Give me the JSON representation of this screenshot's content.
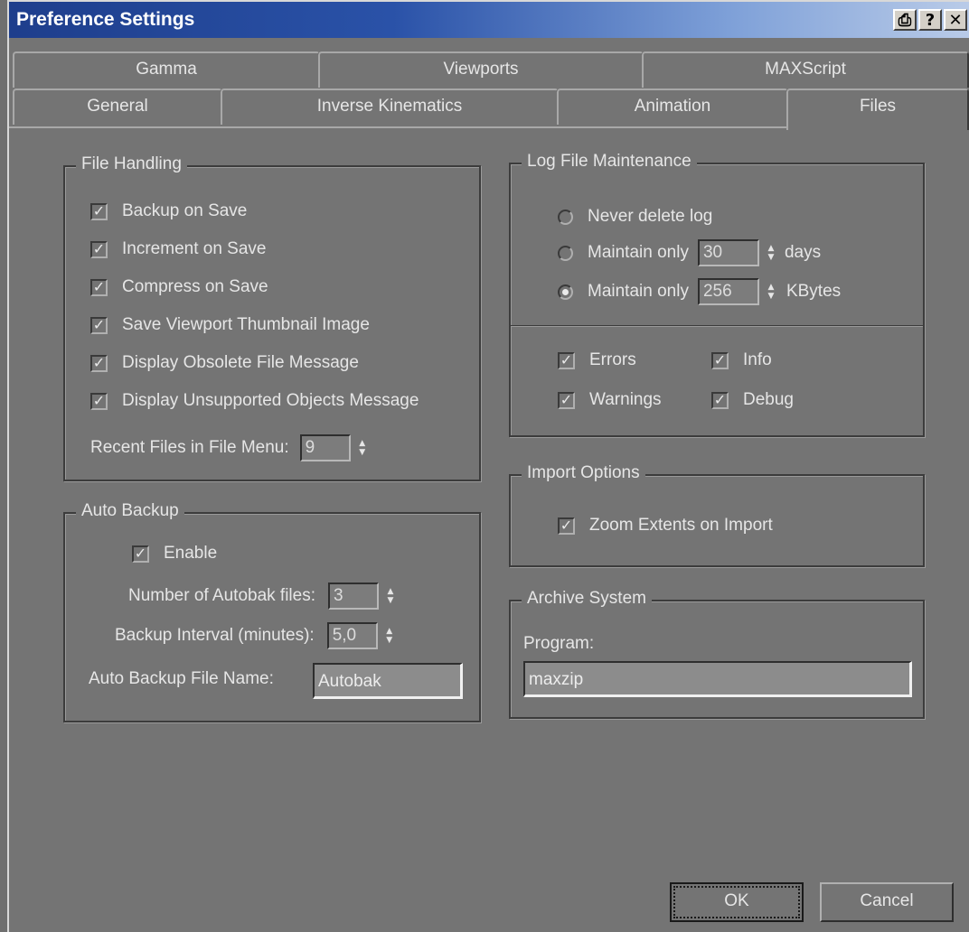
{
  "window": {
    "title": "Preference Settings",
    "controls": [
      "⎙",
      "?",
      "✕"
    ]
  },
  "tabs": {
    "row1": [
      "Gamma",
      "Viewports",
      "MAXScript"
    ],
    "row2": [
      "General",
      "Inverse Kinematics",
      "Animation",
      "Files"
    ],
    "active": "Files"
  },
  "file_handling": {
    "title": "File Handling",
    "options": [
      {
        "label": "Backup on Save",
        "checked": true
      },
      {
        "label": "Increment on Save",
        "checked": true
      },
      {
        "label": "Compress on Save",
        "checked": true
      },
      {
        "label": "Save Viewport Thumbnail Image",
        "checked": true
      },
      {
        "label": "Display Obsolete File Message",
        "checked": true
      },
      {
        "label": "Display Unsupported Objects Message",
        "checked": true
      }
    ],
    "recent_files_label": "Recent Files in File Menu:",
    "recent_files_value": "9"
  },
  "auto_backup": {
    "title": "Auto Backup",
    "enable_label": "Enable",
    "enable_checked": true,
    "num_files_label": "Number of Autobak files:",
    "num_files_value": "3",
    "interval_label": "Backup Interval (minutes):",
    "interval_value": "5,0",
    "file_name_label": "Auto Backup File Name:",
    "file_name_value": "Autobak"
  },
  "log_file": {
    "title": "Log File Maintenance",
    "never_delete_label": "Never delete log",
    "maintain_label": "Maintain only",
    "days_value": "30",
    "days_unit": "days",
    "kbytes_value": "256",
    "kbytes_unit": "KBytes",
    "selected": "kbytes",
    "errors_label": "Errors",
    "info_label": "Info",
    "warnings_label": "Warnings",
    "debug_label": "Debug"
  },
  "import_options": {
    "title": "Import Options",
    "zoom_label": "Zoom Extents on Import"
  },
  "archive": {
    "title": "Archive System",
    "program_label": "Program:",
    "program_value": "maxzip"
  },
  "buttons": {
    "ok": "OK",
    "cancel": "Cancel"
  },
  "icons": {
    "check": "✓",
    "spin": "▲▼"
  }
}
